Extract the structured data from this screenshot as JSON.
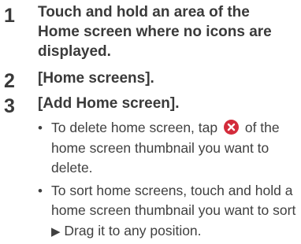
{
  "steps": [
    {
      "number": "1",
      "text": "Touch and hold an area of the Home screen where no icons are displayed."
    },
    {
      "number": "2",
      "text": "[Home screens]."
    },
    {
      "number": "3",
      "text": "[Add Home screen]."
    }
  ],
  "bullets": {
    "delete_before": "To delete home screen, tap",
    "delete_after": "of the home screen thumbnail you want to delete.",
    "sort_before": "To sort home screens, touch and hold a home screen thumbnail you want to sort",
    "sort_arrow": "▶",
    "sort_after": "Drag it to any position.",
    "bullet_char": "•"
  },
  "icons": {
    "delete": "close-circle-icon",
    "delete_color": "#d32b3b"
  }
}
